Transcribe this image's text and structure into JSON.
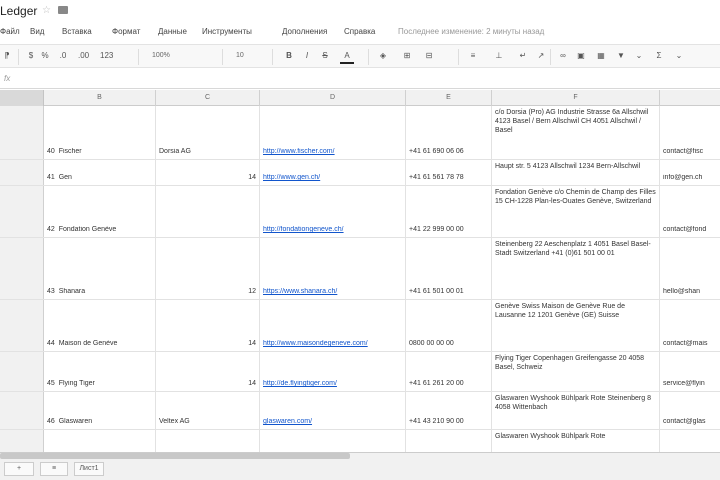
{
  "app": {
    "doc_title": "Ledger"
  },
  "menu": {
    "items": [
      "Файл",
      "Вид",
      "Вставка",
      "Формат",
      "Данные",
      "Инструменты",
      "Дополнения",
      "Справка"
    ],
    "status": "Последнее изменение: 2 минуты назад"
  },
  "toolbar": {
    "zoom": "100%",
    "font_size": "10"
  },
  "formula": {
    "fx": "fx"
  },
  "columns": [
    "B",
    "C",
    "D",
    "E",
    "F"
  ],
  "rows": [
    {
      "num": "40",
      "name": "Fischer",
      "extra": "Dorsia AG",
      "flag": "",
      "url": "http://www.fischer.com/",
      "phone": "+41 61 690 06 06",
      "address": "c/o Dorsia (Pro) AG Industrie Strasse 6a Allschwil 4123 Basel / Bern Allschwil CH  4051 Allschwil / Basel",
      "email": "contact@fisc"
    },
    {
      "num": "41",
      "name": "Gen",
      "extra": "",
      "flag": "14",
      "url": "http://www.gen.ch/",
      "phone": "+41 61 561 78 78",
      "address": "Haupt str. 5 4123 Allschwil 1234 Bern-Allschwil",
      "email": "info@gen.ch"
    },
    {
      "num": "42",
      "name": "Fondation Genève",
      "extra": "",
      "flag": "",
      "url": "http://fondationgeneve.ch/",
      "phone": "+41 22 999 00 00",
      "address": "Fondation Genève c/o Chemin de Champ des Filles 15 CH-1228 Plan-les-Ouates Genève, Switzerland",
      "email": "contact@fond"
    },
    {
      "num": "43",
      "name": "Shanara",
      "extra": "",
      "flag": "12",
      "url": "https://www.shanara.ch/",
      "phone": "+41 61 501 00 01",
      "address": "Steinenberg 22 Aeschenplatz 1 4051 Basel Basel-Stadt Switzerland +41 (0)61 501 00 01",
      "email": "hello@shan"
    },
    {
      "num": "44",
      "name": "Maison de Genève",
      "extra": "",
      "flag": "14",
      "url": "http://www.maisondegeneve.com/",
      "phone": "0800 00 00 00",
      "address": "Genève Swiss Maison de Genève Rue de Lausanne 12 1201 Genève (GE) Suisse",
      "email": "contact@mais"
    },
    {
      "num": "45",
      "name": "Flying Tiger",
      "extra": "",
      "flag": "14",
      "url": "http://de.flyingtiger.com/",
      "phone": "+41 61 261 20 00",
      "address": "Flying Tiger Copenhagen Greifengasse 20 4058 Basel, Schweiz",
      "email": "service@flyin"
    },
    {
      "num": "46",
      "name": "Glaswaren",
      "extra": "Veltex AG",
      "flag": "",
      "url": "glaswaren.com/",
      "phone": "+41 43 210 90 00",
      "address": "Glaswaren Wyshook Bühlpark Rote Steinenberg 8 4058 Wittenbach",
      "email": "contact@glas"
    },
    {
      "num": "",
      "name": "",
      "extra": "",
      "flag": "",
      "url": "",
      "phone": "",
      "address": "Glaswaren Wyshook Bühlpark Rote",
      "email": ""
    }
  ],
  "sheets": {
    "add": "+",
    "list": "≡",
    "tab1": "Лист1"
  }
}
